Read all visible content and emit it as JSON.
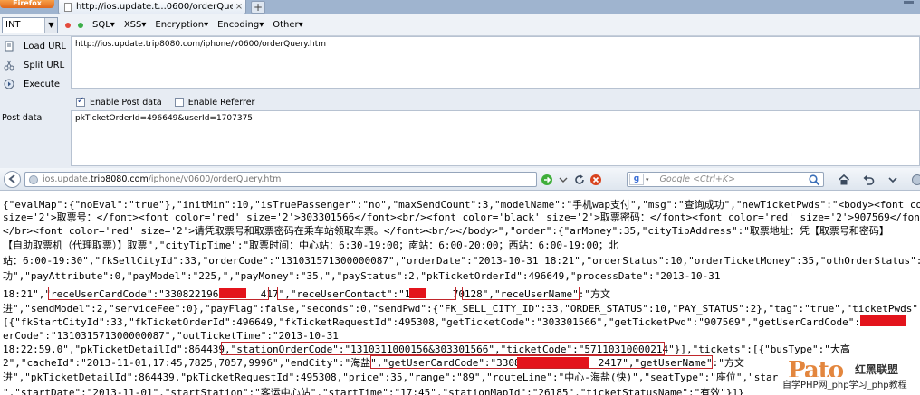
{
  "browser": {
    "brand_label": "Firefox",
    "tab_title": "http://ios.update.t...0600/orderQuery.htm",
    "tab_close": "×",
    "new_tab": "+"
  },
  "hackbar": {
    "selected_type": "INT",
    "menus": [
      "SQL▾",
      "XSS▾",
      "Encryption▾",
      "Encoding▾",
      "Other▾"
    ],
    "actions": {
      "load": "Load URL",
      "split": "Split URL",
      "execute": "Execute"
    },
    "url_value": "http://ios.update.trip8080.com/iphone/v0600/orderQuery.htm",
    "enable_post": "Enable Post data",
    "enable_referrer": "Enable Referrer",
    "post_label": "Post data",
    "post_value": "pkTicketOrderId=496649&userId=1707375"
  },
  "navbar": {
    "url_dim_prefix": "ios.update.",
    "url_host": "trip8080.com",
    "url_path": "/iphone/v0600/orderQuery.htm",
    "search_placeholder": "Google <Ctrl+K>",
    "search_engine_badge": "g"
  },
  "content": {
    "lines": [
      "{\"evalMap\":{\"noEval\":\"true\"},\"initMin\":10,\"isTruePassenger\":\"no\",\"maxSendCount\":3,\"modelName\":\"手机wap支付\",\"msg\":\"查询成功\",\"newTicketPwds\":\"<body><font color",
      "size='2'>取票号：</font><font color='red' size='2'>303301566</font><br/><font color='black' size='2'>取票密码：</font><font color='red' size='2'>907569</font><",
      "</br><font color='red' size='2'>请凭取票号和取票密码在乘车站领取车票。</font><br/></body>\",\"order\":{\"arMoney\":35,\"cityTipAddress\":\"取票地址：凭【取票号和密码】",
      "【自助取票机（代理取票）】取票\",\"cityTipTime\":\"取票时间：中心站：6:30-19:00；南站：6:00-20:00；西站：6:00-19:00；北",
      "站：6:00-19:30\",\"fkSellCityId\":33,\"orderCode\":\"131031571300000087\",\"orderDate\":\"2013-10-31 18:21\",\"orderStatus\":10,\"orderTicketMoney\":35,\"othOrderStatus\":\"123",
      "功\",\"payAttribute\":0,\"payModel\":\"225,\",\"payMoney\":\"35,\",\"payStatus\":2,\"pkTicketOrderId\":496649,\"processDate\":\"2013-10-31",
      "18:21\",\"receUserCardCode\":\"3308221969      417\",\"receUserContact\":\"13      70128\",\"receUserName\":\"方文",
      "进\",\"sendModel\":2,\"serviceFee\":0},\"payFlag\":false,\"seconds\":0,\"sendPwd\":{\"FK_SELL_CITY_ID\":33,\"ORDER_STATUS\":10,\"PAY_STATUS\":2},\"tag\":\"true\",\"ticketPwds\":",
      "[{\"fkStartCityId\":33,\"fkTicketOrderId\":496649,\"fkTicketRequestId\":495308,\"getTicketCode\":\"303301566\",\"getTicketPwd\":\"907569\",\"getUserCardCode\":\"3308         192",
      "erCode\":\"131031571300000087\",\"outTicketTime\":\"2013-10-31",
      "18:22:59.0\",\"pkTicketDetailId\":864439,\"stationOrderCode\":\"1310311000156&303301566\",\"ticketCode\":\"57110310000214\"}],\"tickets\":[{\"busType\":\"大高",
      "2\",\"cacheId\":\"2013-11-01,17:45,7825,7057,9996\",\"endCity\":\"海盐\",\"getUserCardCode\":\"330822           2417\",\"getUserName\":\"方文",
      "进\",\"pkTicketDetailId\":864439,\"pkTicketRequestId\":495308,\"price\":35,\"range\":\"89\",\"routeLine\":\"中心-海盐(快)\",\"seatType\":\"座位\",\"star",
      "\",\"startDate\":\"2013-11-01\",\"startStation\":\"客运中心站\",\"startTime\":\"17:45\",\"stationMapId\":\"26185\",\"ticketStatusName\":\"有效\"}]}"
    ],
    "watermark_logo": "Pato",
    "watermark_name": "红黑联盟",
    "watermark_tagline": "自学PHP网_php学习_php教程"
  },
  "colors": {
    "highlight_box": "#c0262b",
    "redaction": "#e3141c",
    "hackbar_bg": "#e7ecf3",
    "tabstrip_bg": "#9fb4cf",
    "firefox_orange": "#e0671a"
  },
  "icons": {
    "load": "load-url-icon",
    "split": "split-url-icon",
    "execute": "execute-icon"
  }
}
